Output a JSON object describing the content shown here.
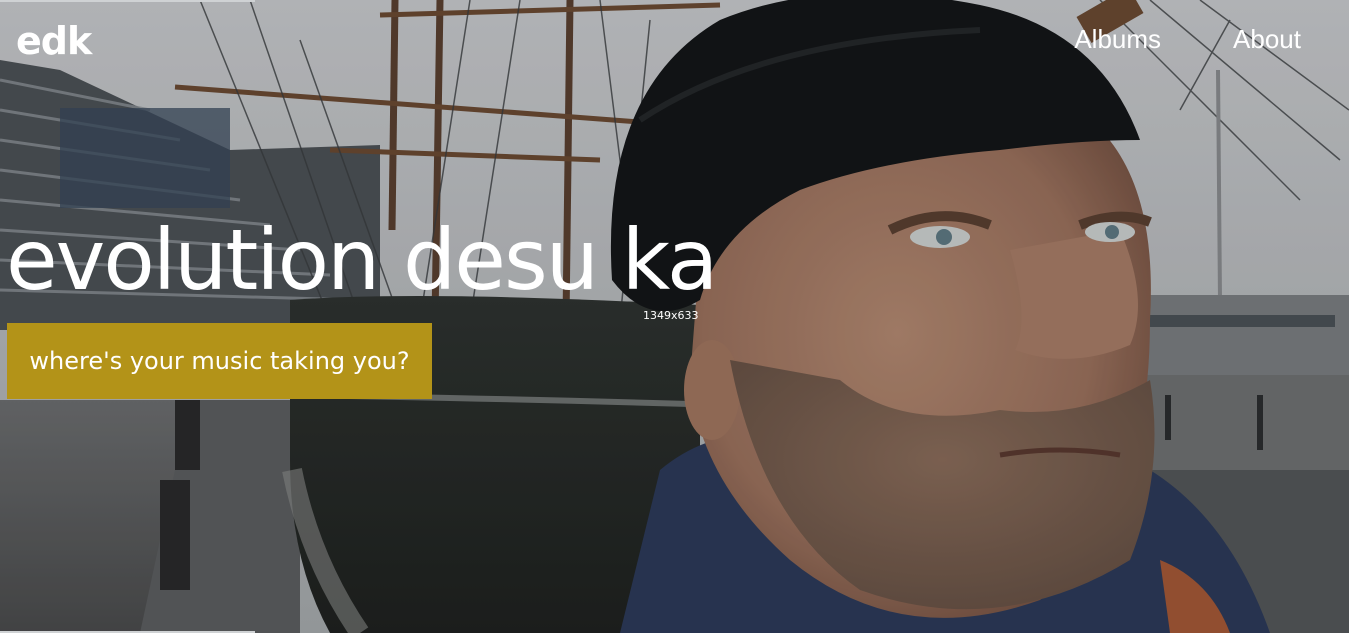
{
  "header": {
    "logo": "edk",
    "nav": [
      {
        "label": "Albums"
      },
      {
        "label": "About"
      }
    ]
  },
  "hero": {
    "title": "evolution desu ka",
    "cta_label": "where's your music taking you?",
    "image_label": "1349x633"
  },
  "colors": {
    "cta_background": "#b39318",
    "text": "#ffffff"
  }
}
